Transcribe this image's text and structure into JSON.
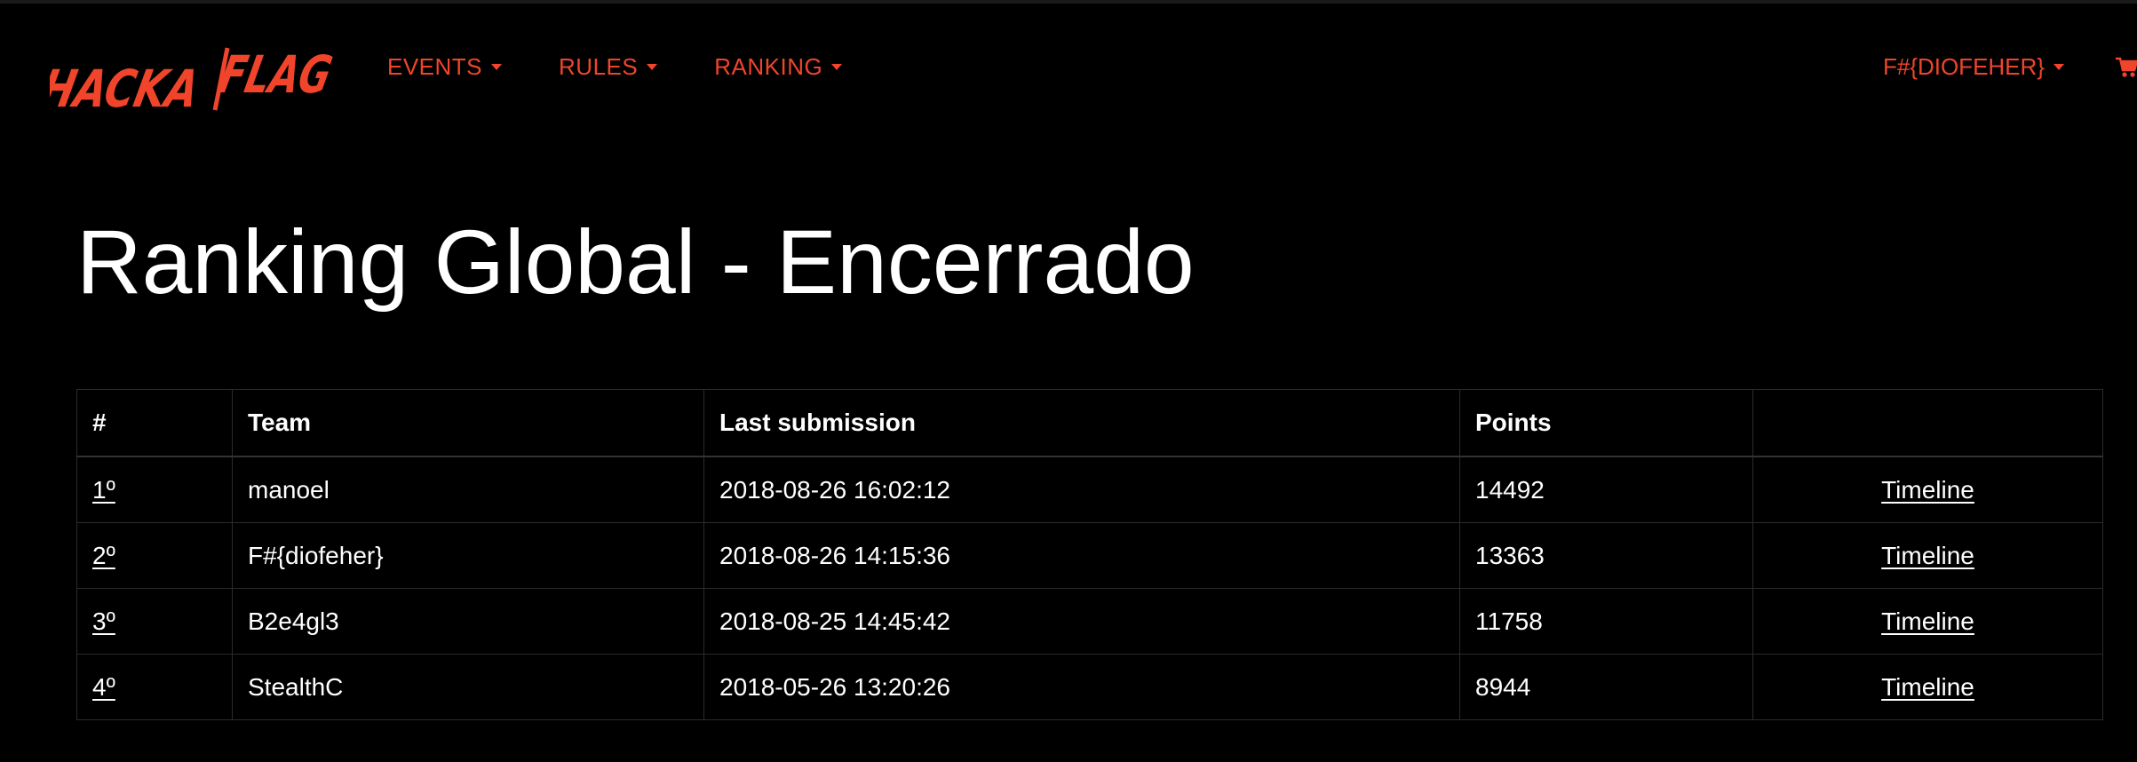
{
  "navbar": {
    "logo_text_left": "HACKA",
    "logo_text_right": "FLAG",
    "menu": [
      {
        "label": "EVENTS"
      },
      {
        "label": "RULES"
      },
      {
        "label": "RANKING"
      }
    ],
    "user_label": "F#{DIOFEHER}",
    "cart_icon": "shopping-cart-icon",
    "accent_color": "#f0452b"
  },
  "page_title": "Ranking Global - Encerrado",
  "table": {
    "headers": [
      "#",
      "Team",
      "Last submission",
      "Points",
      ""
    ],
    "rows": [
      {
        "rank": "1º",
        "team": "manoel",
        "last_submission": "2018-08-26 16:02:12",
        "points": "14492",
        "timeline": "Timeline"
      },
      {
        "rank": "2º",
        "team": "F#{diofeher}",
        "last_submission": "2018-08-26 14:15:36",
        "points": "13363",
        "timeline": "Timeline"
      },
      {
        "rank": "3º",
        "team": "B2e4gl3",
        "last_submission": "2018-08-25 14:45:42",
        "points": "11758",
        "timeline": "Timeline"
      },
      {
        "rank": "4º",
        "team": "StealthC",
        "last_submission": "2018-05-26 13:20:26",
        "points": "8944",
        "timeline": "Timeline"
      }
    ]
  }
}
